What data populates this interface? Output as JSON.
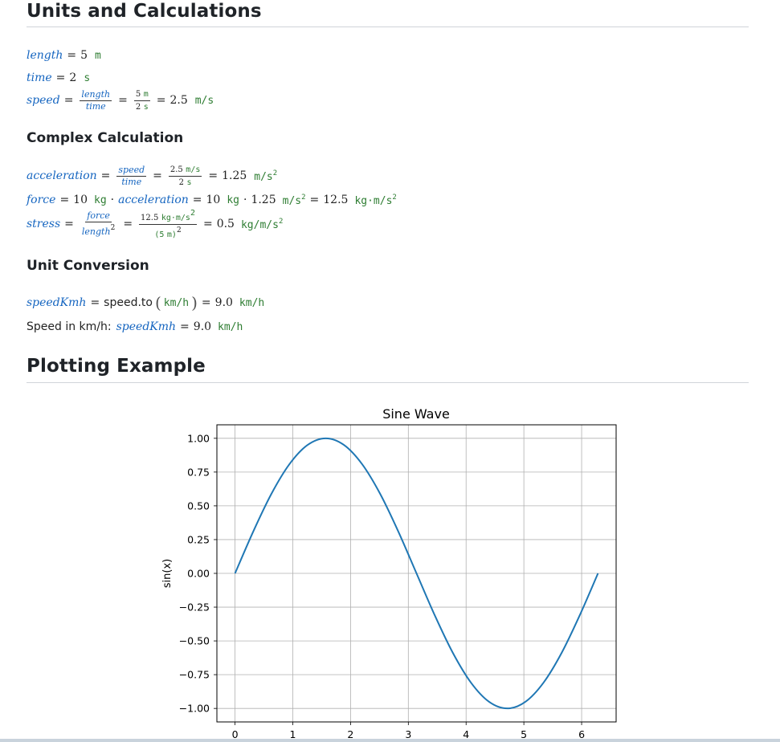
{
  "headings": {
    "units": "Units and Calculations",
    "complex": "Complex Calculation",
    "conversion": "Unit Conversion",
    "plotting": "Plotting Example"
  },
  "calc": {
    "length": {
      "name": "length",
      "value": "5",
      "unit": "m"
    },
    "time": {
      "name": "time",
      "value": "2",
      "unit": "s"
    },
    "speed": {
      "name": "speed",
      "num_var": "length",
      "den_var": "time",
      "num_val": "5",
      "num_unit": "m",
      "den_val": "2",
      "den_unit": "s",
      "result": "2.5",
      "unit": "m/s"
    },
    "acceleration": {
      "name": "acceleration",
      "num_var": "speed",
      "den_var": "time",
      "num_val": "2.5",
      "num_unit": "m/s",
      "den_val": "2",
      "den_unit": "s",
      "result": "1.25",
      "unit": "m/s",
      "exp": "2"
    },
    "force": {
      "name": "force",
      "mass": "10",
      "mass_unit": "kg",
      "times": "·",
      "var": "acceleration",
      "mass2": "10",
      "mass2_unit": "kg",
      "acc_val": "1.25",
      "acc_unit": "m/s",
      "acc_exp": "2",
      "result": "12.5",
      "result_unit": "kg·m/s",
      "result_exp": "2"
    },
    "stress": {
      "name": "stress",
      "num_var": "force",
      "den_var": "length",
      "den_exp": "2",
      "num_val": "12.5",
      "num_unit": "kg·m/s",
      "num_exp": "2",
      "den_open": "(5",
      "den_unit": "m)",
      "den_pow": "2",
      "result": "0.5",
      "unit": "kg/m/s",
      "exp": "2"
    }
  },
  "conversion": {
    "var": "speedKmh",
    "expr": "speed.to",
    "arg_unit": "km/h",
    "result": "9.0",
    "unit": "km/h",
    "label": "Speed in km/h:",
    "var2": "speedKmh",
    "result2": "9.0",
    "unit2": "km/h"
  },
  "colors": {
    "variable": "#1565c0",
    "unit": "#2e7d32",
    "line": "#1f77b4"
  },
  "chart_data": {
    "type": "line",
    "title": "Sine Wave",
    "xlabel": "",
    "ylabel": "sin(x)",
    "xlim": [
      -0.3142,
      6.5973
    ],
    "ylim": [
      -1.1,
      1.1
    ],
    "xticks": [
      0,
      1,
      2,
      3,
      4,
      5,
      6
    ],
    "yticks": [
      1.0,
      0.75,
      0.5,
      0.25,
      0.0,
      -0.25,
      -0.5,
      -0.75,
      -1.0
    ],
    "ytick_labels": [
      "1.00",
      "0.75",
      "0.50",
      "0.25",
      "0.00",
      "−0.25",
      "−0.50",
      "−0.75",
      "−1.00"
    ],
    "grid": true,
    "series": [
      {
        "x": [
          0,
          0.3142,
          0.6283,
          0.9425,
          1.2566,
          1.5708,
          1.885,
          2.1991,
          2.5133,
          2.8274,
          3.1416,
          3.4558,
          3.7699,
          4.0841,
          4.3982,
          4.7124,
          5.0265,
          5.3407,
          5.6549,
          5.969,
          6.2832
        ],
        "values": [
          0,
          0.309,
          0.588,
          0.809,
          0.951,
          1.0,
          0.951,
          0.809,
          0.588,
          0.309,
          0,
          -0.309,
          -0.588,
          -0.809,
          -0.951,
          -1.0,
          -0.951,
          -0.809,
          -0.588,
          -0.309,
          0
        ]
      }
    ]
  }
}
